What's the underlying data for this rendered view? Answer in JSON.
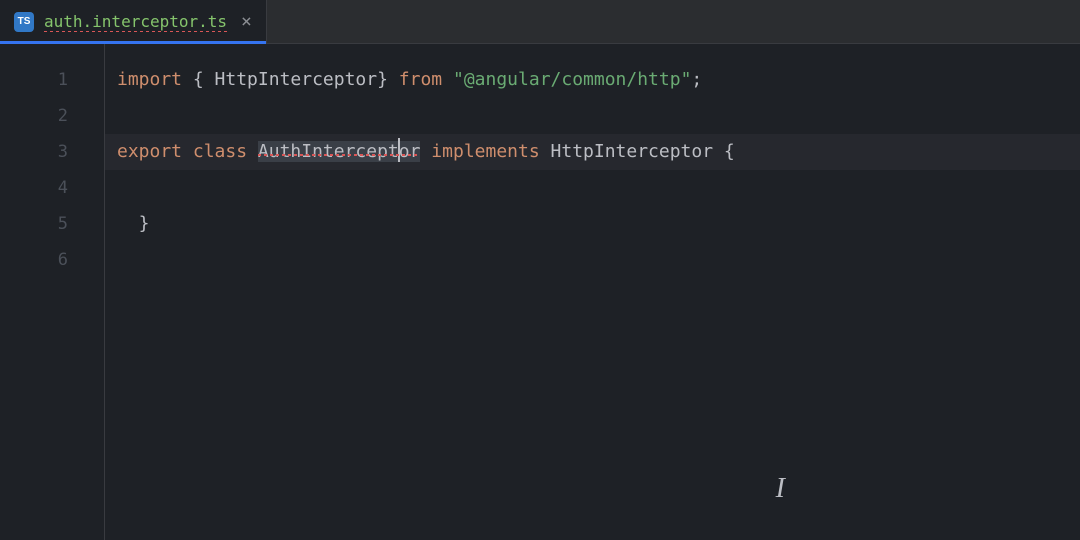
{
  "tab": {
    "icon_label": "TS",
    "filename": "auth.interceptor.ts",
    "close_glyph": "×"
  },
  "gutter": {
    "lines": [
      "1",
      "2",
      "3",
      "4",
      "5",
      "6"
    ]
  },
  "code": {
    "line1": {
      "kw_import": "import",
      "brace_open": " { ",
      "type": "HttpInterceptor",
      "brace_close": "} ",
      "kw_from": "from",
      "string": " \"@angular/common/http\"",
      "semi": ";"
    },
    "line3": {
      "kw_export": "export",
      "kw_class": " class ",
      "classname_pre": "AuthIntercept",
      "classname_post": "or",
      "kw_implements": " implements ",
      "interface": "HttpInterceptor",
      "brace": " {"
    },
    "line5": {
      "brace_close": "  }"
    }
  },
  "cursor_indicator": "I"
}
